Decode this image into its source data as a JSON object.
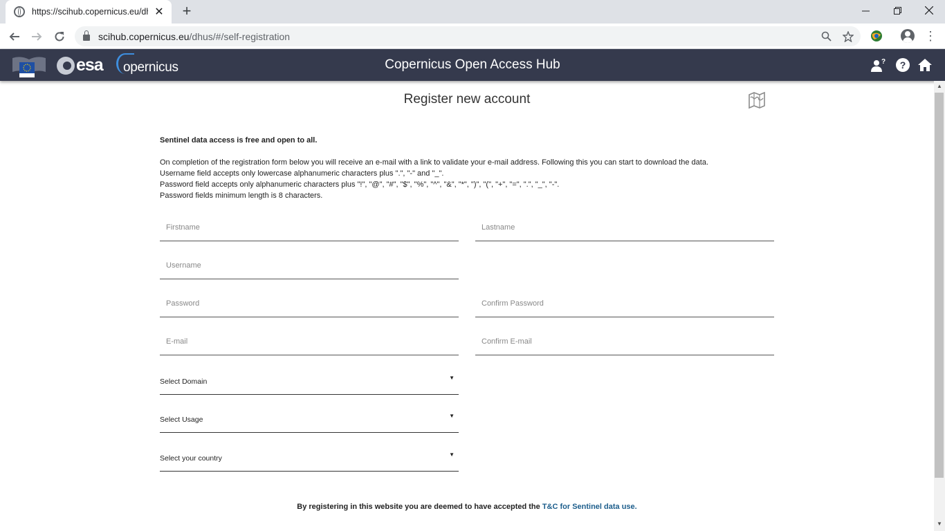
{
  "browser": {
    "tab_title": "https://scihub.copernicus.eu/dhus",
    "url_host": "scihub.copernicus.eu",
    "url_path": "/dhus/#/self-registration"
  },
  "header": {
    "title": "Copernicus Open Access Hub",
    "esa_text": "esa",
    "copernicus_text": "opernicus"
  },
  "page": {
    "title": "Register new account",
    "intro_bold": "Sentinel data access is free and open to all.",
    "intro_lines": [
      "On completion of the registration form below you will receive an e-mail with a link to validate your e-mail address. Following this you can start to download the data.",
      "Username field accepts only lowercase alphanumeric characters plus \".\", \"-\" and \"_\".",
      "Password field accepts only alphanumeric characters plus \"!\", \"@\", \"#\", \"$\", \"%\", \"^\", \"&\", \"*\", \")\", \"(\", \"+\", \"=\", \".\", \"_\", \"-\".",
      "Password fields minimum length is 8 characters."
    ]
  },
  "form": {
    "firstname": "Firstname",
    "lastname": "Lastname",
    "username": "Username",
    "password": "Password",
    "confirm_password": "Confirm Password",
    "email": "E-mail",
    "confirm_email": "Confirm E-mail",
    "domain": "Select Domain",
    "usage": "Select Usage",
    "country": "Select your country"
  },
  "footer": {
    "note": "By registering in this website you are deemed to have accepted the ",
    "link": "T&C for Sentinel data use."
  },
  "icons": {
    "favicon": "globe-icon",
    "back": "back-arrow-icon",
    "forward": "forward-arrow-icon",
    "reload": "reload-icon",
    "zoom": "zoom-icon",
    "bookmark": "star-icon",
    "register": "person-question-icon",
    "help": "help-icon",
    "home": "home-icon",
    "map": "map-icon"
  },
  "colors": {
    "header_bg": "#353a4d",
    "link": "#1d5e8c",
    "copernicus_blue": "#3e8ede"
  }
}
